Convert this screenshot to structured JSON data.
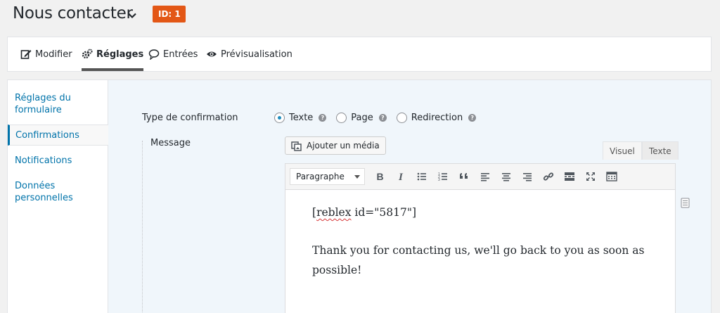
{
  "header": {
    "title": "Nous contacter",
    "id_badge": "ID: 1"
  },
  "toolbar": {
    "items": [
      {
        "label": "Modifier",
        "icon": "edit-icon"
      },
      {
        "label": "Réglages",
        "icon": "gears-icon",
        "active": true
      },
      {
        "label": "Entrées",
        "icon": "comment-icon"
      },
      {
        "label": "Prévisualisation",
        "icon": "eye-icon"
      }
    ]
  },
  "sidebar": {
    "items": [
      {
        "label_line1": "Réglages du",
        "label_line2": "formulaire"
      },
      {
        "label_line1": "Confirmations",
        "active": true
      },
      {
        "label_line1": "Notifications"
      },
      {
        "label_line1": "Données",
        "label_line2": "personnelles"
      }
    ]
  },
  "confirmation": {
    "type_label": "Type de confirmation",
    "options": [
      {
        "label": "Texte",
        "checked": true
      },
      {
        "label": "Page",
        "checked": false
      },
      {
        "label": "Redirection",
        "checked": false
      }
    ],
    "help_glyph": "?",
    "message_label": "Message"
  },
  "editor": {
    "media_button": "Ajouter un média",
    "tab_visual": "Visuel",
    "tab_text": "Texte",
    "format_select": "Paragraphe",
    "buttons": [
      "bold-icon",
      "italic-icon",
      "bulleted-list-icon",
      "numbered-list-icon",
      "blockquote-icon",
      "align-left-icon",
      "align-center-icon",
      "align-right-icon",
      "link-icon",
      "read-more-icon",
      "fullscreen-icon",
      "toolbar-toggle-icon"
    ],
    "content": {
      "shortcode_prefix": "[",
      "shortcode_word": "reblex",
      "shortcode_rest": " id=\"5817\"]",
      "paragraph": "Thank you for contacting us, we'll go back to you as soon as possible!"
    }
  },
  "colors": {
    "accent": "#0073aa",
    "badge": "#e35716",
    "content_bg": "#f0f6fb"
  }
}
